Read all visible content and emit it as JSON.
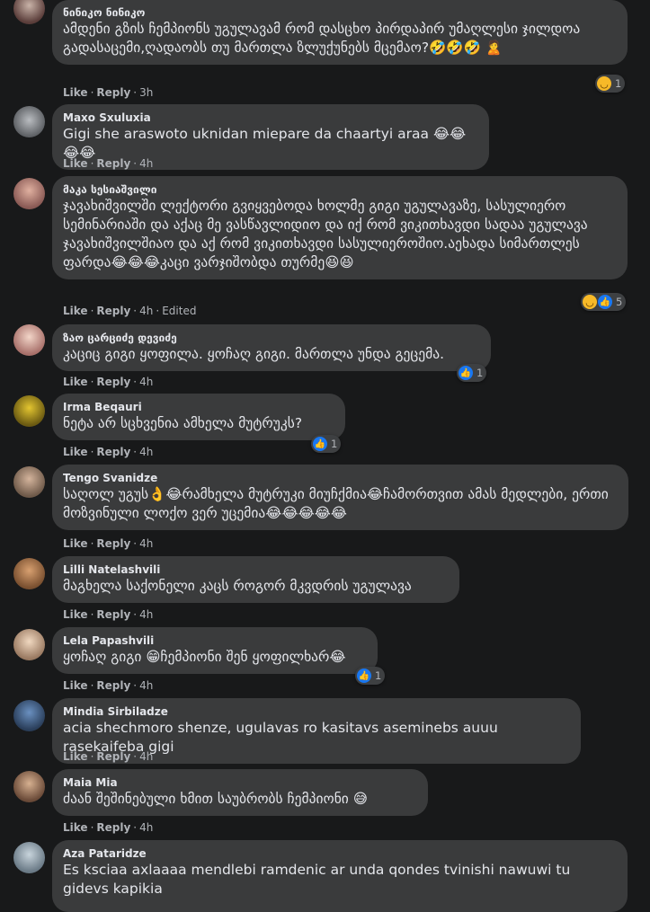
{
  "actions": {
    "like": "Like",
    "reply": "Reply"
  },
  "colors": {
    "background": "#18191a",
    "bubble": "#3a3b3c",
    "meta": "#b0b3b8",
    "like_blue": "#1877f2",
    "haha_yellow": "#f7b928"
  },
  "comments": [
    {
      "author": "ნინიკო ნინიკო",
      "text": "ამდენი გზის ჩემპიონს უგულავამ რომ დასცხო პირდაპირ უმაღლესი ჯილდოა გადასაცემი,ღადაობს თუ მართლა ზლუქუნებს მცემაო?🤣🤣🤣 🙎",
      "time": "3h",
      "edited": "",
      "reaction_count": "1",
      "reactions": [
        "haha"
      ]
    },
    {
      "author": "Maxo Sxuluxia",
      "text": "Gigi she araswoto uknidan miepare da chaartyi araa 😂😂😂😂",
      "time": "4h",
      "edited": "",
      "reaction_count": "",
      "reactions": []
    },
    {
      "author": "მაკა სესიაშვილი",
      "text": "ჯავახიშვილში ლექტორი გვიყვებოდა ხოლმე გიგი უგულავაზე, სასულიერო სემინარიაში და აქაც მე ვასწავლიდიო და იქ რომ ვიკითხავდი სადაა უგულავა ჯავახიშვილშიაო და აქ რომ ვიკითხავდი სასულიეროშიო.აეხადა სიმართლეს ფარდა😂😂😂კაცი ვარჯიშობდა თურმე😆😆",
      "time": "4h",
      "edited": "Edited",
      "reaction_count": "5",
      "reactions": [
        "haha",
        "like"
      ]
    },
    {
      "author": "ზაო ცარციძე დევიძე",
      "text": "კაციც გიგი ყოფილა. ყოჩაღ გიგი. მართლა უნდა გეცემა.",
      "time": "4h",
      "edited": "",
      "reaction_count": "1",
      "reactions": [
        "like"
      ]
    },
    {
      "author": "Irma Beqauri",
      "text": "ნეტა არ სცხვენია ამხელა მუტრუკს?",
      "time": "4h",
      "edited": "",
      "reaction_count": "1",
      "reactions": [
        "like"
      ]
    },
    {
      "author": "Tengo Svanidze",
      "text": "საღოლ უგუს👌😂რამხელა მუტრუკი მიუჩქმია😂ჩამორთვით ამას მედლები, ერთი მოზვინული ლოქო ვერ უცემია😂😂😂😂😂",
      "time": "4h",
      "edited": "",
      "reaction_count": "",
      "reactions": []
    },
    {
      "author": "Lilli Natelashvili",
      "text": "მაგხელა საქონელი კაცს როგორ მკვდრის უგულავა",
      "time": "4h",
      "edited": "",
      "reaction_count": "",
      "reactions": []
    },
    {
      "author": "Lela Papashvili",
      "text": "ყოჩაღ გიგი 😁ჩემპიონი შენ ყოფილხარ😂",
      "time": "4h",
      "edited": "",
      "reaction_count": "1",
      "reactions": [
        "like"
      ]
    },
    {
      "author": "Mindia Sirbiladze",
      "text": "acia shechmoro shenze, ugulavas ro kasitavs aseminebs auuu rasekaifeba gigi",
      "time": "4h",
      "edited": "",
      "reaction_count": "",
      "reactions": []
    },
    {
      "author": "Maia Mia",
      "text": "ძაან შეშინებული ხმით საუბრობს ჩემპიონი 😅",
      "time": "4h",
      "edited": "",
      "reaction_count": "",
      "reactions": []
    },
    {
      "author": "Aza Pataridze",
      "text": "Es ksciaa axlaaaa mendlebi ramdenic ar unda qondes tvinishi nawuwi tu gidevs kapikia",
      "time": "",
      "edited": "",
      "reaction_count": "",
      "reactions": []
    }
  ]
}
